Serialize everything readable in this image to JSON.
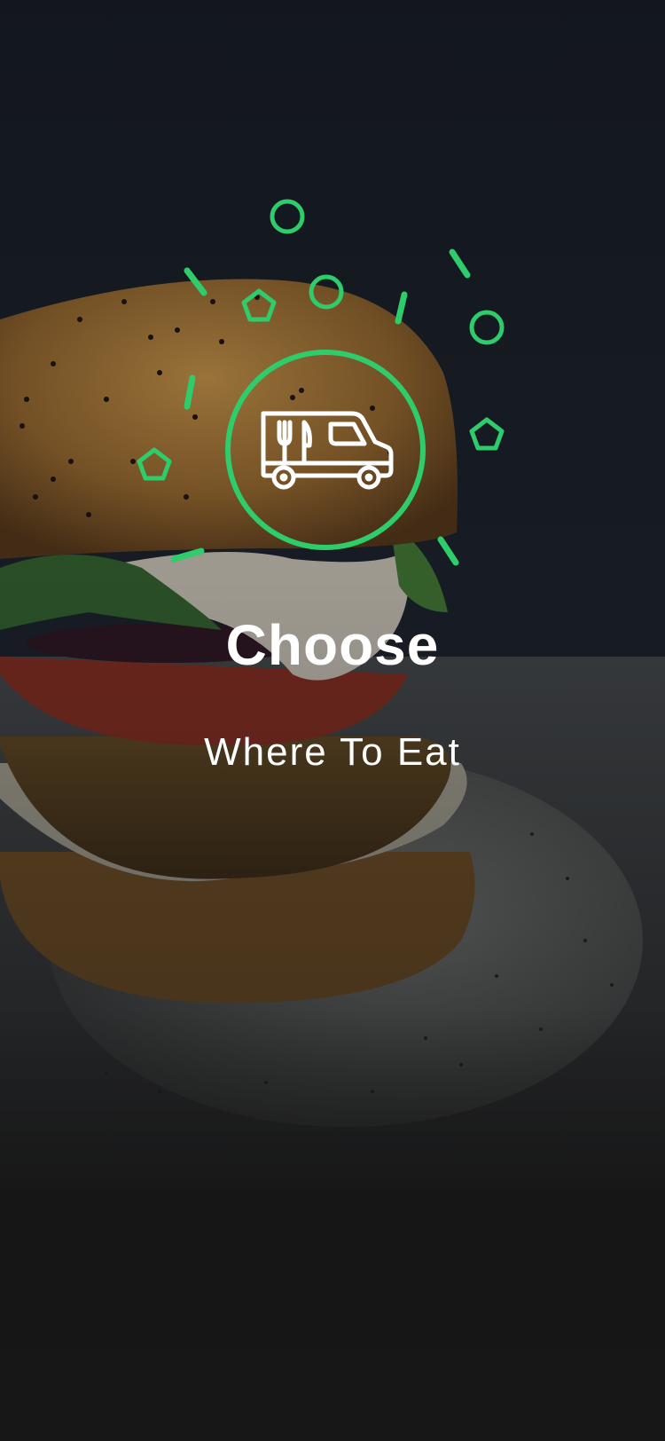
{
  "onboarding": {
    "title": "Choose",
    "subtitle": "Where To Eat",
    "illustration_icon": "food-truck-icon",
    "background_image": "burger-photo"
  },
  "colors": {
    "accent": "#2ecc6a",
    "text": "#ffffff",
    "background": "#171717"
  }
}
